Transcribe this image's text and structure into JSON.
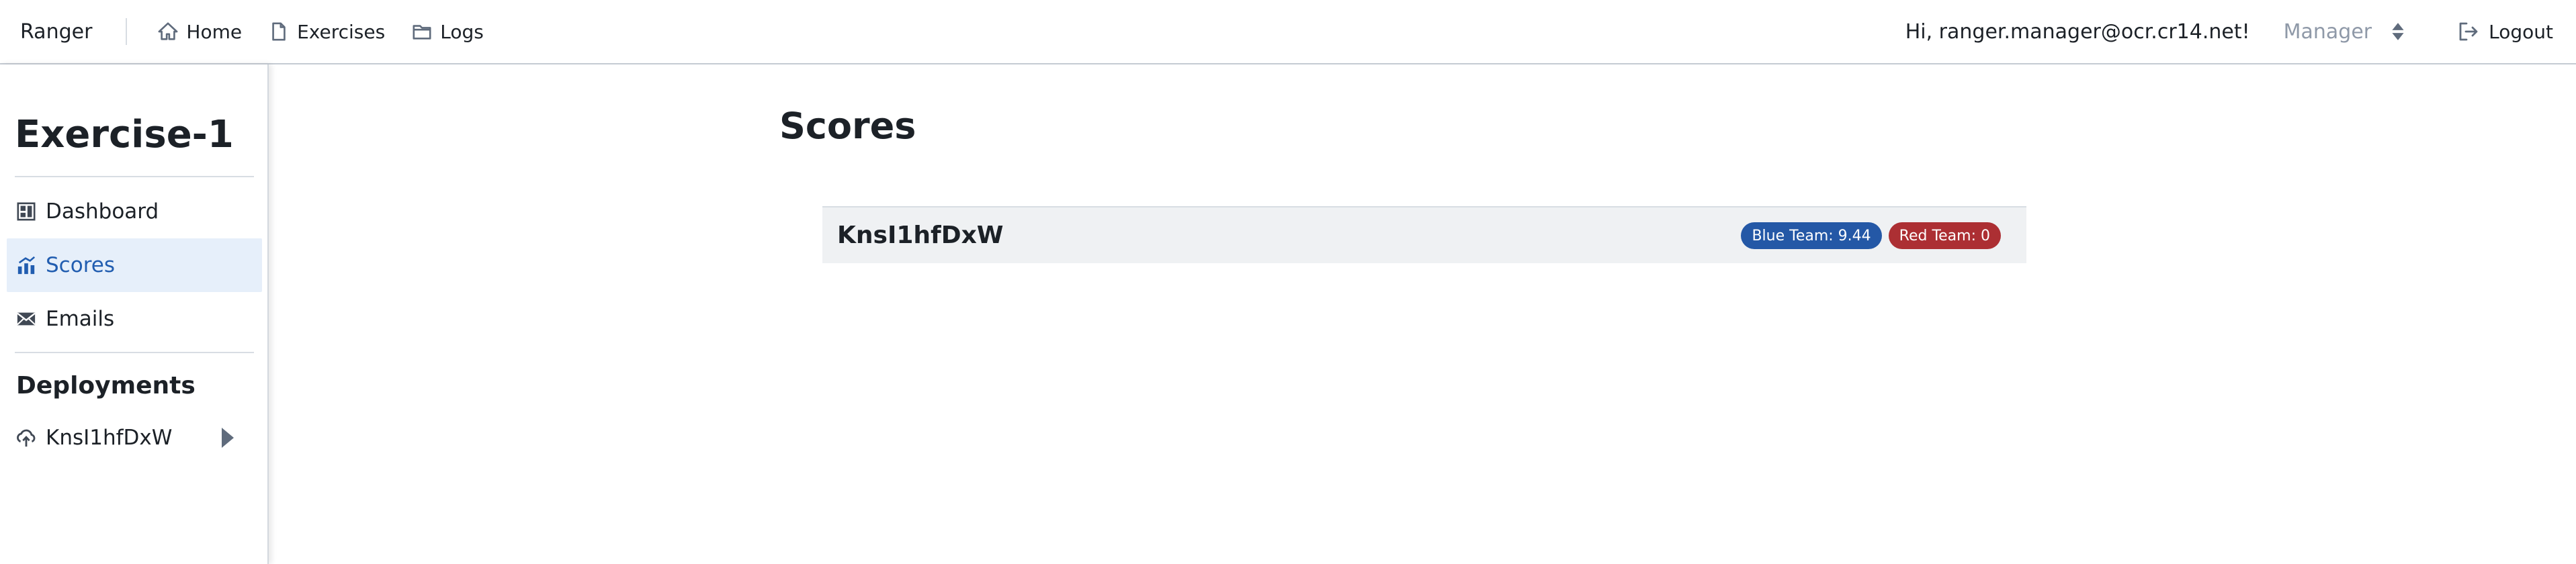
{
  "navbar": {
    "brand": "Ranger",
    "items": [
      {
        "label": "Home",
        "icon": "home-icon"
      },
      {
        "label": "Exercises",
        "icon": "document-icon"
      },
      {
        "label": "Logs",
        "icon": "folder-icon"
      }
    ],
    "greeting": "Hi, ranger.manager@ocr.cr14.net!",
    "role": "Manager",
    "logout": "Logout"
  },
  "sidebar": {
    "exercise_title": "Exercise-1",
    "items": [
      {
        "label": "Dashboard",
        "icon": "dashboard-icon",
        "active": false
      },
      {
        "label": "Scores",
        "icon": "chart-icon",
        "active": true
      },
      {
        "label": "Emails",
        "icon": "envelope-icon",
        "active": false
      }
    ],
    "deployments_heading": "Deployments",
    "deployments": [
      {
        "label": "KnsI1hfDxW",
        "icon": "cloud-upload-icon"
      }
    ]
  },
  "main": {
    "title": "Scores",
    "cards": [
      {
        "name": "KnsI1hfDxW",
        "badges": [
          {
            "label": "Blue Team: 9.44",
            "color": "#2458a6"
          },
          {
            "label": "Red Team: 0",
            "color": "#ac2f33"
          }
        ]
      }
    ]
  },
  "colors": {
    "accent": "#215db0",
    "active_bg": "#e6effa",
    "card_bg": "#eff1f3"
  }
}
